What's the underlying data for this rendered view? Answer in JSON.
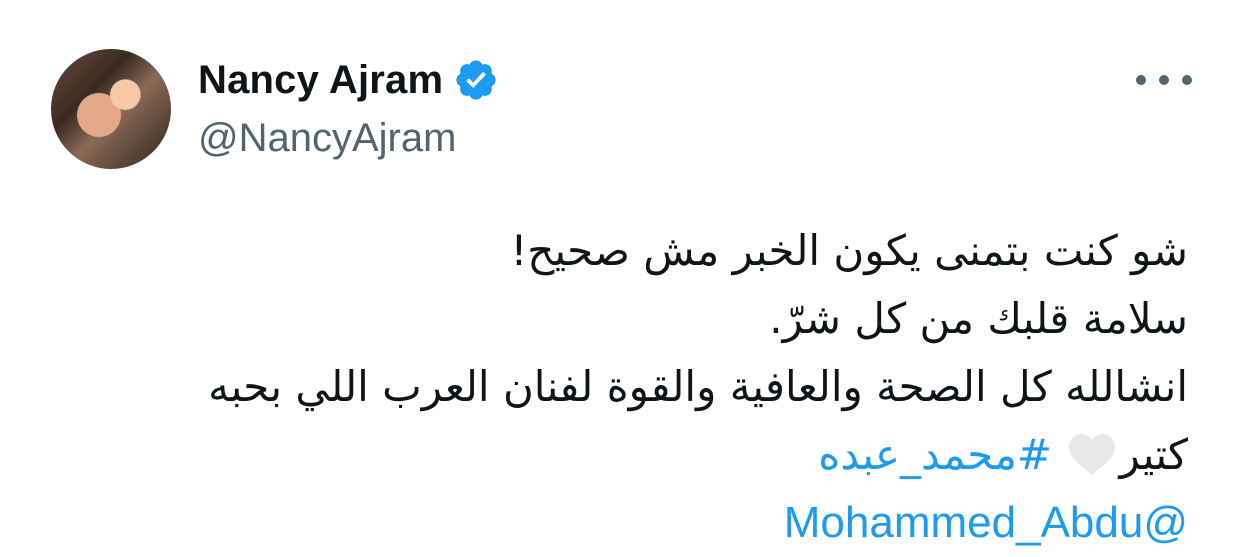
{
  "user": {
    "display_name": "Nancy Ajram",
    "handle": "@NancyAjram"
  },
  "tweet": {
    "lines": [
      "شو كنت بتمنى يكون الخبر مش صحيح!",
      "سلامة قلبك من كل شرّ.",
      "انشالله كل الصحة والعافية والقوة لفنان العرب اللي بحبه"
    ],
    "last_line_text": "كتير",
    "hashtag": "#محمد_عبده",
    "mention": "@Mohammed_Abdu"
  },
  "icons": {
    "verified": "verified-badge-icon",
    "more": "more-options-icon",
    "heart": "white-heart-emoji"
  },
  "colors": {
    "link": "#1d9bf0",
    "verified": "#1d9bf0",
    "secondary_text": "#536471"
  }
}
